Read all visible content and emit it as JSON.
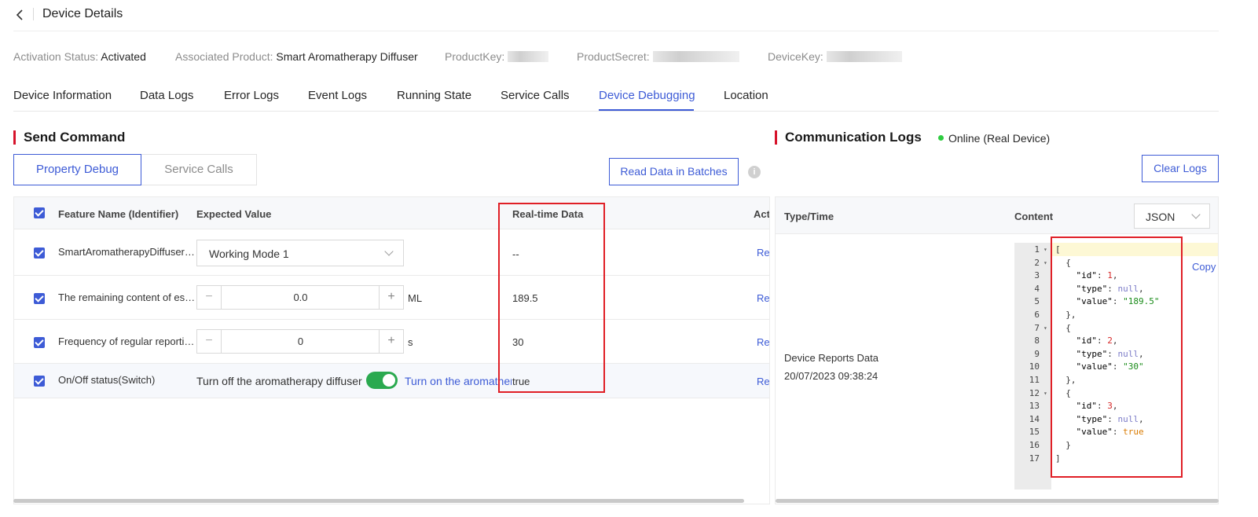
{
  "header": {
    "title": "Device Details"
  },
  "meta": {
    "activation_label": "Activation Status:",
    "activation_value": "Activated",
    "product_label": "Associated Product:",
    "product_value": "Smart Aromatherapy Diffuser",
    "productkey_label": "ProductKey:",
    "productsecret_label": "ProductSecret:",
    "devicekey_label": "DeviceKey:"
  },
  "tabs": [
    {
      "label": "Device Information"
    },
    {
      "label": "Data Logs"
    },
    {
      "label": "Error Logs"
    },
    {
      "label": "Event Logs"
    },
    {
      "label": "Running State"
    },
    {
      "label": "Service Calls"
    },
    {
      "label": "Device Debugging",
      "active": true
    },
    {
      "label": "Location"
    }
  ],
  "send_command": {
    "title": "Send Command",
    "mode_tabs": {
      "property": "Property Debug",
      "service": "Service Calls"
    },
    "batch_button": "Read Data in Batches",
    "info_glyph": "i",
    "columns": {
      "feature": "Feature Name (Identifier)",
      "expected": "Expected Value",
      "realtime": "Real-time Data",
      "action": "Act"
    },
    "rows": [
      {
        "feature": "SmartAromatherapyDiffuser…",
        "expected": "Working Mode 1",
        "realtime": "--",
        "action": "Re"
      },
      {
        "feature": "The remaining content of es…",
        "expected": "0.0",
        "unit": "ML",
        "realtime": "189.5",
        "action": "Re"
      },
      {
        "feature": "Frequency of regular reporti…",
        "expected": "0",
        "unit": "s",
        "realtime": "30",
        "action": "Re"
      },
      {
        "feature": "On/Off status(Switch)",
        "off_label": "Turn off the aromatherapy diffuser",
        "on_label": "Turn on the aromather",
        "switch_on": true,
        "realtime": "true",
        "action": "Re"
      }
    ],
    "stepper_minus": "−",
    "stepper_plus": "+"
  },
  "comm_logs": {
    "title": "Communication Logs",
    "status": "Online (Real Device)",
    "status_color": "#2ecc40",
    "clear_button": "Clear Logs",
    "columns": {
      "type_time": "Type/Time",
      "content": "Content"
    },
    "format_select": "JSON",
    "entry": {
      "type": "Device Reports Data",
      "time": "20/07/2023 09:38:24"
    },
    "copy_label": "Copy",
    "code_lines": [
      "[",
      "  {",
      "    \"id\": 1,",
      "    \"type\": null,",
      "    \"value\": \"189.5\"",
      "  },",
      "  {",
      "    \"id\": 2,",
      "    \"type\": null,",
      "    \"value\": \"30\"",
      "  },",
      "  {",
      "    \"id\": 3,",
      "    \"type\": null,",
      "    \"value\": true",
      "  }",
      "]"
    ]
  },
  "colors": {
    "accent": "#3d5bd6",
    "section_marker": "#d6132b",
    "highlight_box": "#e01f26",
    "switch_on": "#2aa94f"
  }
}
